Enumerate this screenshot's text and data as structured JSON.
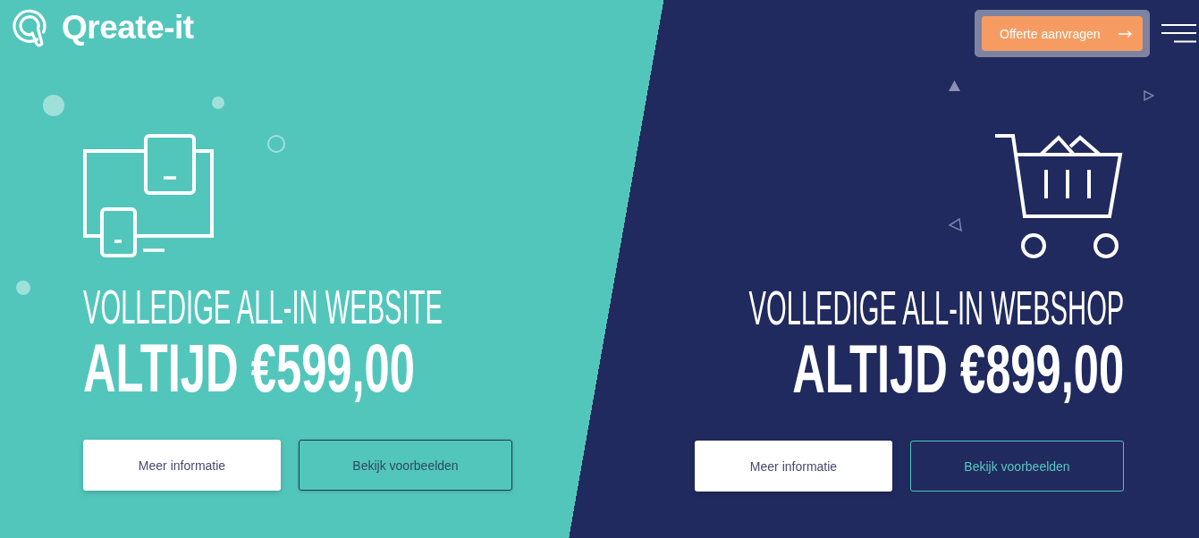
{
  "header": {
    "logo": {
      "text": "Qreate-it"
    },
    "cta_button": {
      "label": "Offerte aanvragen"
    }
  },
  "offers": [
    {
      "kind": "website",
      "title": "VOLLEDIGE ALL-IN WEBSITE",
      "price": "ALTIJD €599,00",
      "buttons": [
        {
          "kind": "solid",
          "label": "Meer informatie"
        },
        {
          "kind": "outline",
          "label": "Bekijk voorbeelden"
        }
      ]
    },
    {
      "kind": "webshop",
      "title": "VOLLEDIGE ALL-IN WEBSHOP",
      "price": "ALTIJD €899,00",
      "buttons": [
        {
          "kind": "solid",
          "label": "Meer informatie"
        },
        {
          "kind": "outline",
          "label": "Bekijk voorbeelden"
        }
      ]
    }
  ]
}
